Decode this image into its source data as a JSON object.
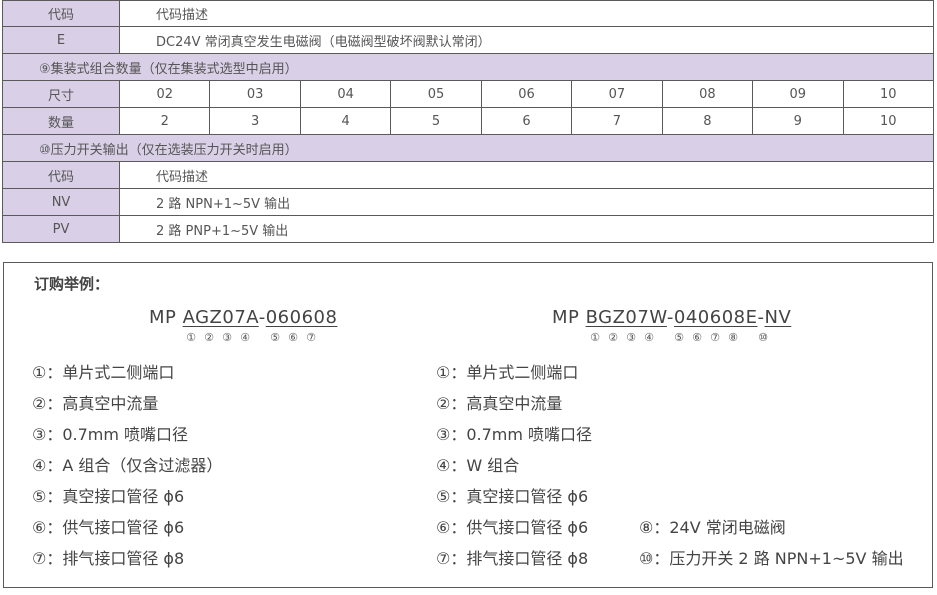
{
  "valve_table": {
    "header": {
      "code": "代码",
      "desc": "代码描述"
    },
    "row_e": {
      "code": "E",
      "desc": "DC24V 常闭真空发生电磁阀（电磁阀型破坏阀默认常闭）"
    }
  },
  "combo_section": {
    "title": "⑨集装式组合数量（仅在集装式选型中启用）",
    "size_label": "尺寸",
    "count_label": "数量",
    "sizes": [
      "02",
      "03",
      "04",
      "05",
      "06",
      "07",
      "08",
      "09",
      "10"
    ],
    "counts": [
      "2",
      "3",
      "4",
      "5",
      "6",
      "7",
      "8",
      "9",
      "10"
    ]
  },
  "pressure_section": {
    "title": "⑩压力开关输出（仅在选装压力开关时启用）",
    "header": {
      "code": "代码",
      "desc": "代码描述"
    },
    "rows": [
      {
        "code": "NV",
        "desc": "2 路 NPN+1~5V 输出"
      },
      {
        "code": "PV",
        "desc": "2 路 PNP+1~5V 输出"
      }
    ]
  },
  "order_example": {
    "title": "订购举例：",
    "left": {
      "prefix": "MP ",
      "code_a": "AGZ07A",
      "dash": "-",
      "code_b": "060608",
      "markers_a": [
        "①",
        "②",
        "③",
        "④"
      ],
      "markers_b": [
        "⑤",
        "⑥",
        "⑦"
      ],
      "items": [
        "①：单片式二侧端口",
        "②：高真空中流量",
        "③：0.7mm 喷嘴口径",
        "④：A 组合（仅含过滤器）",
        "⑤：真空接口管径 ϕ6",
        "⑥：供气接口管径 ϕ6",
        "⑦：排气接口管径 ϕ8"
      ]
    },
    "right": {
      "prefix": "MP ",
      "code_a": "BGZ07W",
      "dash": "-",
      "code_b": "040608E",
      "dash2": "-",
      "code_c": "NV",
      "markers_a": [
        "①",
        "②",
        "③",
        "④"
      ],
      "markers_b": [
        "⑤",
        "⑥",
        "⑦",
        "⑧"
      ],
      "markers_c": [
        "⑩"
      ],
      "items": [
        "①：单片式二侧端口",
        "②：高真空中流量",
        "③：0.7mm 喷嘴口径",
        "④：W 组合",
        "⑤：真空接口管径 ϕ6",
        "⑥：供气接口管径 ϕ6",
        "⑦：排气接口管径 ϕ8"
      ],
      "extra_items": [
        "⑧：24V 常闭电磁阀",
        "⑩：压力开关 2 路 NPN+1~5V 输出"
      ]
    }
  }
}
